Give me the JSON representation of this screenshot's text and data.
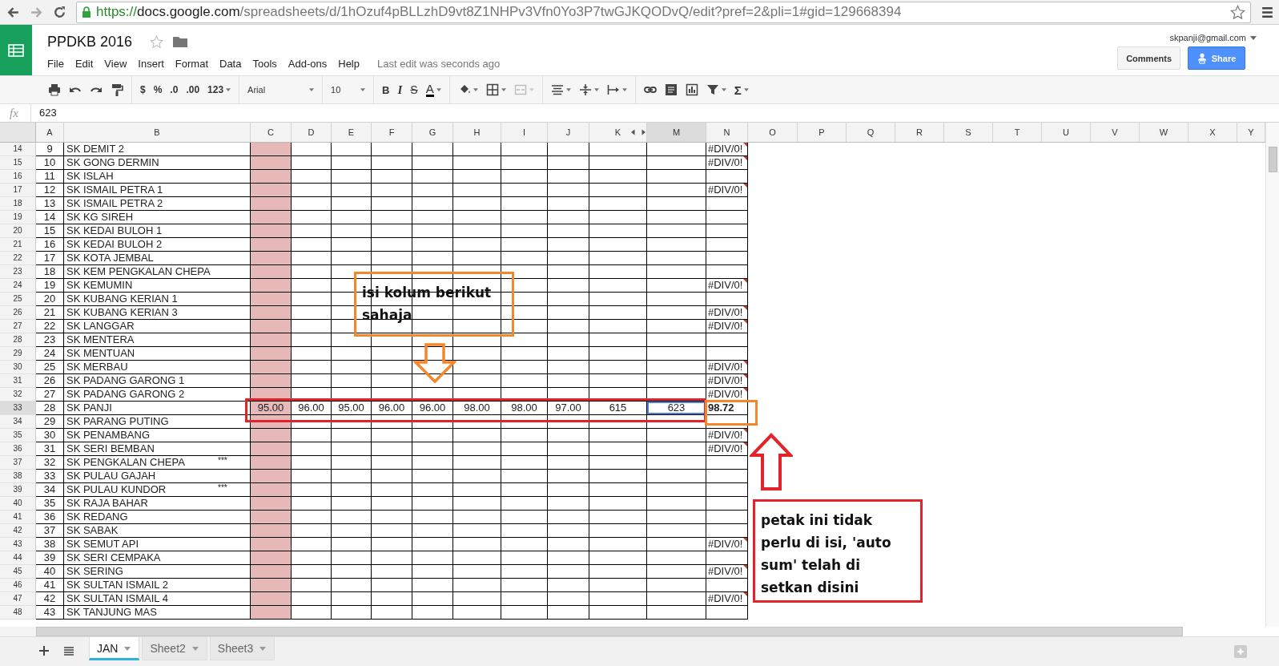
{
  "browser": {
    "url_scheme": "https://",
    "url_host": "docs.google.com",
    "url_path": "/spreadsheets/d/1hOzuf4pBLLzhD9vt8Z1NHPv3Vfn0Yo3P7twGJKQODvQ/edit?pref=2&pli=1#gid=129668394"
  },
  "document": {
    "title": "PPDKB 2016",
    "menus": [
      "File",
      "Edit",
      "View",
      "Insert",
      "Format",
      "Data",
      "Tools",
      "Add-ons",
      "Help"
    ],
    "last_edit": "Last edit was seconds ago",
    "account": "skpanji@gmail.com",
    "comments_button": "Comments",
    "share_button": "Share"
  },
  "toolbar": {
    "currency": "$",
    "percent": "%",
    "decrease_decimals": ".0",
    "increase_decimals": ".00",
    "more_formats": "123",
    "font": "Arial",
    "font_size": "10",
    "bold": "B",
    "italic": "I",
    "strikethrough": "S",
    "text_color": "A",
    "functions": "Σ"
  },
  "formula_bar": {
    "label": "fx",
    "value": "623"
  },
  "sheet": {
    "columns": [
      {
        "label": "A",
        "selected": false,
        "kind": "plain"
      },
      {
        "label": "B",
        "selected": false,
        "kind": "plain"
      },
      {
        "label": "C",
        "selected": false,
        "kind": "shaded"
      },
      {
        "label": "D",
        "selected": false,
        "kind": "plain"
      },
      {
        "label": "E",
        "selected": false,
        "kind": "plain"
      },
      {
        "label": "F",
        "selected": false,
        "kind": "plain"
      },
      {
        "label": "G",
        "selected": false,
        "kind": "plain"
      },
      {
        "label": "H",
        "selected": false,
        "kind": "plain"
      },
      {
        "label": "I",
        "selected": false,
        "kind": "plain"
      },
      {
        "label": "J",
        "selected": false,
        "kind": "plain"
      },
      {
        "label": "K",
        "selected": false,
        "kind": "before_hidden"
      },
      {
        "label": "M",
        "selected": true,
        "kind": "plain"
      },
      {
        "label": "N",
        "selected": false,
        "kind": "plain"
      },
      {
        "label": "O",
        "selected": false,
        "kind": "plain"
      },
      {
        "label": "P",
        "selected": false,
        "kind": "plain"
      },
      {
        "label": "Q",
        "selected": false,
        "kind": "plain"
      },
      {
        "label": "R",
        "selected": false,
        "kind": "plain"
      },
      {
        "label": "S",
        "selected": false,
        "kind": "plain"
      },
      {
        "label": "T",
        "selected": false,
        "kind": "plain"
      },
      {
        "label": "U",
        "selected": false,
        "kind": "plain"
      },
      {
        "label": "V",
        "selected": false,
        "kind": "plain"
      },
      {
        "label": "W",
        "selected": false,
        "kind": "plain"
      },
      {
        "label": "X",
        "selected": false,
        "kind": "plain"
      },
      {
        "label": "Y",
        "selected": false,
        "kind": "plain"
      }
    ],
    "rows": [
      {
        "number": "14",
        "a": "9",
        "b": "SK DEMIT 2",
        "selected": false,
        "n": {
          "text": "#DIV/0!",
          "kind": "error"
        }
      },
      {
        "number": "15",
        "a": "10",
        "b": "SK GONG DERMIN",
        "selected": false,
        "n": {
          "text": "#DIV/0!",
          "kind": "error"
        }
      },
      {
        "number": "16",
        "a": "11",
        "b": "SK ISLAH",
        "selected": false
      },
      {
        "number": "17",
        "a": "12",
        "b": "SK ISMAIL PETRA 1",
        "selected": false,
        "n": {
          "text": "#DIV/0!",
          "kind": "error"
        }
      },
      {
        "number": "18",
        "a": "13",
        "b": "SK ISMAIL PETRA 2",
        "selected": false
      },
      {
        "number": "19",
        "a": "14",
        "b": "SK KG SIREH",
        "selected": false
      },
      {
        "number": "20",
        "a": "15",
        "b": "SK KEDAI BULOH 1",
        "selected": false
      },
      {
        "number": "21",
        "a": "16",
        "b": "SK KEDAI BULOH 2",
        "selected": false
      },
      {
        "number": "22",
        "a": "17",
        "b": "SK KOTA JEMBAL",
        "selected": false
      },
      {
        "number": "23",
        "a": "18",
        "b": "SK KEM PENGKALAN CHEPA",
        "selected": false
      },
      {
        "number": "24",
        "a": "19",
        "b": "SK KEMUMIN",
        "selected": false,
        "n": {
          "text": "#DIV/0!",
          "kind": "error"
        }
      },
      {
        "number": "25",
        "a": "20",
        "b": "SK KUBANG KERIAN 1",
        "selected": false
      },
      {
        "number": "26",
        "a": "21",
        "b": "SK KUBANG KERIAN 3",
        "selected": false,
        "n": {
          "text": "#DIV/0!",
          "kind": "error"
        }
      },
      {
        "number": "27",
        "a": "22",
        "b": "SK LANGGAR",
        "selected": false,
        "n": {
          "text": "#DIV/0!",
          "kind": "error"
        }
      },
      {
        "number": "28",
        "a": "23",
        "b": "SK MENTERA",
        "selected": false
      },
      {
        "number": "29",
        "a": "24",
        "b": "SK MENTUAN",
        "selected": false
      },
      {
        "number": "30",
        "a": "25",
        "b": "SK MERBAU",
        "selected": false,
        "n": {
          "text": "#DIV/0!",
          "kind": "error"
        }
      },
      {
        "number": "31",
        "a": "26",
        "b": "SK PADANG GARONG 1",
        "selected": false,
        "n": {
          "text": "#DIV/0!",
          "kind": "error"
        }
      },
      {
        "number": "32",
        "a": "27",
        "b": "SK PADANG GARONG 2",
        "selected": false,
        "n": {
          "text": "#DIV/0!",
          "kind": "error"
        }
      },
      {
        "number": "33",
        "a": "28",
        "b": "SK PANJI",
        "selected": true,
        "values": [
          {
            "text": "95.00",
            "selected": false
          },
          {
            "text": "96.00",
            "selected": false
          },
          {
            "text": "95.00",
            "selected": false
          },
          {
            "text": "96.00",
            "selected": false
          },
          {
            "text": "96.00",
            "selected": false
          },
          {
            "text": "98.00",
            "selected": false
          },
          {
            "text": "98.00",
            "selected": false
          },
          {
            "text": "97.00",
            "selected": false
          },
          {
            "text": "615",
            "selected": false
          },
          {
            "text": "623",
            "selected": true
          }
        ],
        "n": {
          "text": "98.72",
          "kind": "total"
        }
      },
      {
        "number": "34",
        "a": "29",
        "b": "SK PARANG PUTING",
        "selected": false
      },
      {
        "number": "35",
        "a": "30",
        "b": "SK PENAMBANG",
        "selected": false,
        "n": {
          "text": "#DIV/0!",
          "kind": "error"
        }
      },
      {
        "number": "36",
        "a": "31",
        "b": "SK SERI BEMBAN",
        "selected": false,
        "n": {
          "text": "#DIV/0!",
          "kind": "error"
        }
      },
      {
        "number": "37",
        "a": "32",
        "b": "SK PENGKALAN CHEPA",
        "note": "***",
        "selected": false
      },
      {
        "number": "38",
        "a": "33",
        "b": "SK PULAU GAJAH",
        "selected": false
      },
      {
        "number": "39",
        "a": "34",
        "b": "SK PULAU KUNDOR",
        "note": "***",
        "selected": false
      },
      {
        "number": "40",
        "a": "35",
        "b": "SK RAJA BAHAR",
        "selected": false
      },
      {
        "number": "41",
        "a": "36",
        "b": "SK REDANG",
        "selected": false
      },
      {
        "number": "42",
        "a": "37",
        "b": "SK SABAK",
        "selected": false
      },
      {
        "number": "43",
        "a": "38",
        "b": "SK SEMUT API",
        "selected": false,
        "n": {
          "text": "#DIV/0!",
          "kind": "error"
        }
      },
      {
        "number": "44",
        "a": "39",
        "b": "SK SERI CEMPAKA",
        "selected": false
      },
      {
        "number": "45",
        "a": "40",
        "b": "SK SERING",
        "selected": false,
        "n": {
          "text": "#DIV/0!",
          "kind": "error"
        }
      },
      {
        "number": "46",
        "a": "41",
        "b": "SK SULTAN ISMAIL 2",
        "selected": false
      },
      {
        "number": "47",
        "a": "42",
        "b": "SK SULTAN ISMAIL 4",
        "selected": false,
        "n": {
          "text": "#DIV/0!",
          "kind": "error"
        }
      },
      {
        "number": "48",
        "a": "43",
        "b": "SK TANJUNG MAS",
        "selected": false
      }
    ]
  },
  "annotations": [
    {
      "kind": "note",
      "color": "#f5862a",
      "text": "isi kolum berikut sahaja"
    },
    {
      "kind": "down_arrow",
      "color": "#f5862a"
    },
    {
      "kind": "frame",
      "color": "#e3232c"
    },
    {
      "kind": "frame",
      "color": "#f5862a"
    },
    {
      "kind": "up_arrow",
      "color": "#e3232c"
    },
    {
      "kind": "note",
      "color": "#e3232c",
      "text": "petak ini tidak perlu di isi, 'auto sum' telah di setkan disini"
    }
  ],
  "sheet_tabs": [
    {
      "label": "JAN",
      "selected": true
    },
    {
      "label": "Sheet2",
      "selected": false
    },
    {
      "label": "Sheet3",
      "selected": false
    }
  ]
}
